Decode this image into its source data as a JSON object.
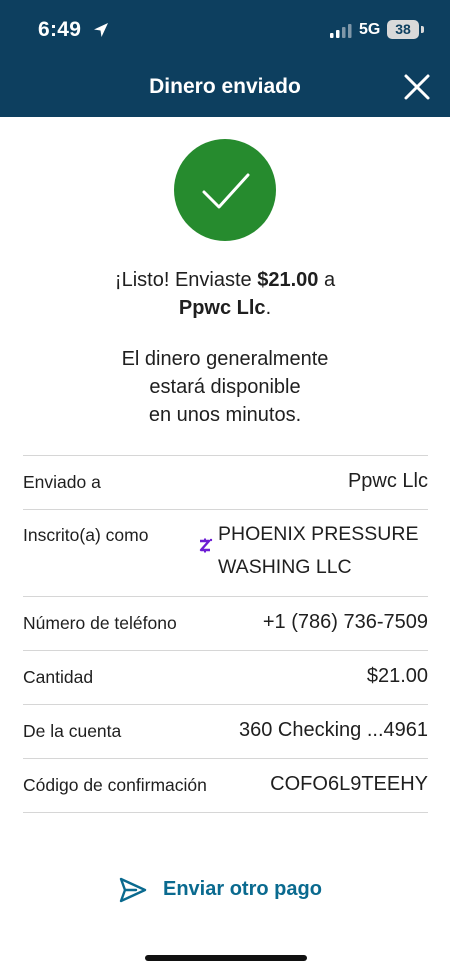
{
  "status_bar": {
    "time": "6:49",
    "network": "5G",
    "battery": "38"
  },
  "header": {
    "title": "Dinero enviado"
  },
  "confirmation": {
    "prefix": "¡Listo! Enviaste ",
    "amount": "$21.00",
    "middle": " a",
    "recipient": "Ppwc Llc",
    "suffix": ".",
    "availability_line1": "El dinero generalmente",
    "availability_line2": "estará disponible",
    "availability_line3": "en unos minutos."
  },
  "details": {
    "sent_to_label": "Enviado a",
    "sent_to_value": "Ppwc Llc",
    "enrolled_as_label": "Inscrito(a) como",
    "enrolled_as_line1": "PHOENIX PRESSURE",
    "enrolled_as_line2": "WASHING LLC",
    "phone_label": "Número de teléfono",
    "phone_value": "+1 (786) 736-7509",
    "amount_label": "Cantidad",
    "amount_value": "$21.00",
    "account_label": "De la cuenta",
    "account_value": "360 Checking ...4961",
    "code_label": "Código de confirmación",
    "code_value": "COFO6L9TEEHY"
  },
  "actions": {
    "send_another": "Enviar otro pago"
  },
  "colors": {
    "header_bg": "#0d3f5f",
    "success_green": "#268b2e",
    "link_blue": "#0a6a8f",
    "zelle_purple": "#6d1ed4"
  },
  "icons": {
    "location": "location-arrow-icon",
    "close": "close-icon",
    "success": "checkmark-icon",
    "zelle": "zelle-icon",
    "send": "send-arrow-icon"
  }
}
